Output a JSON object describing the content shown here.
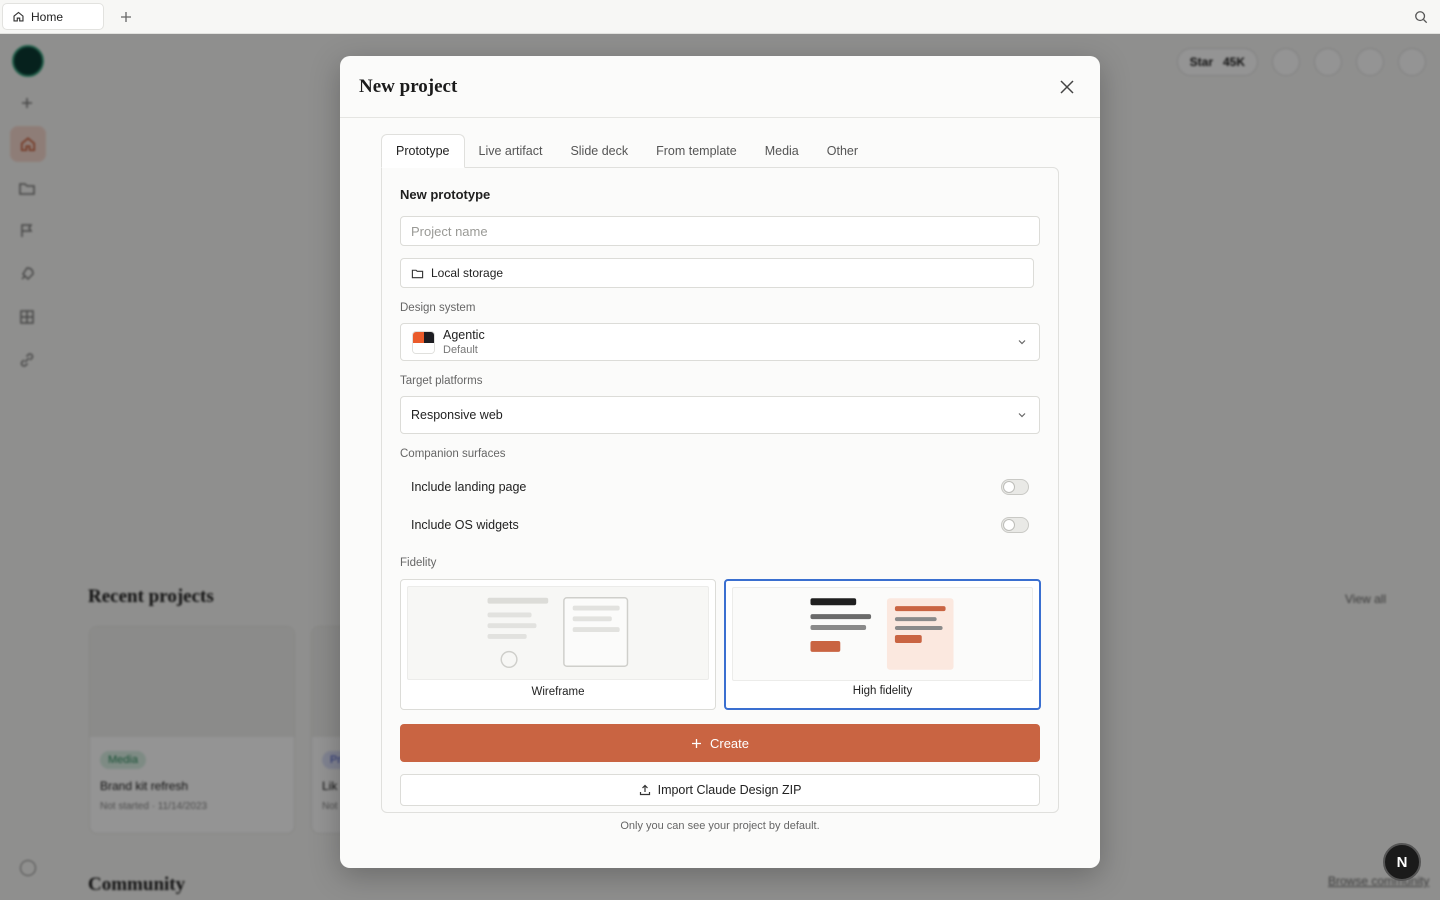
{
  "browser": {
    "tab_label": "Home"
  },
  "background": {
    "star_label": "Star",
    "star_count": "45K",
    "recent_title": "Recent projects",
    "view_all": "View all",
    "community_title": "Community",
    "browse_label": "Browse community",
    "cards": [
      {
        "badge": "Media",
        "name": "Brand kit refresh",
        "meta": "Not started · 11/14/2023"
      },
      {
        "badge": "Pr",
        "name": "Lik",
        "meta": "Not"
      }
    ]
  },
  "dialog": {
    "title": "New project",
    "tabs": [
      {
        "label": "Prototype"
      },
      {
        "label": "Live artifact"
      },
      {
        "label": "Slide deck"
      },
      {
        "label": "From template"
      },
      {
        "label": "Media"
      },
      {
        "label": "Other"
      }
    ],
    "heading": "New prototype",
    "project_name": {
      "value": "",
      "placeholder": "Project name"
    },
    "storage_label": "Local storage",
    "design_system": {
      "label": "Design system",
      "name": "Agentic",
      "sub": "Default"
    },
    "target_platforms": {
      "label": "Target platforms",
      "value": "Responsive web"
    },
    "companion": {
      "label": "Companion surfaces",
      "landing_page": "Include landing page",
      "os_widgets": "Include OS widgets"
    },
    "fidelity": {
      "label": "Fidelity",
      "wireframe": "Wireframe",
      "high": "High fidelity",
      "selected": "High fidelity"
    },
    "create_label": "Create",
    "import_label": "Import Claude Design ZIP",
    "footnote": "Only you can see your project by default."
  },
  "colors": {
    "accent": "#c96442",
    "selected_border": "#3a6fd0"
  },
  "assistant_badge": "N"
}
